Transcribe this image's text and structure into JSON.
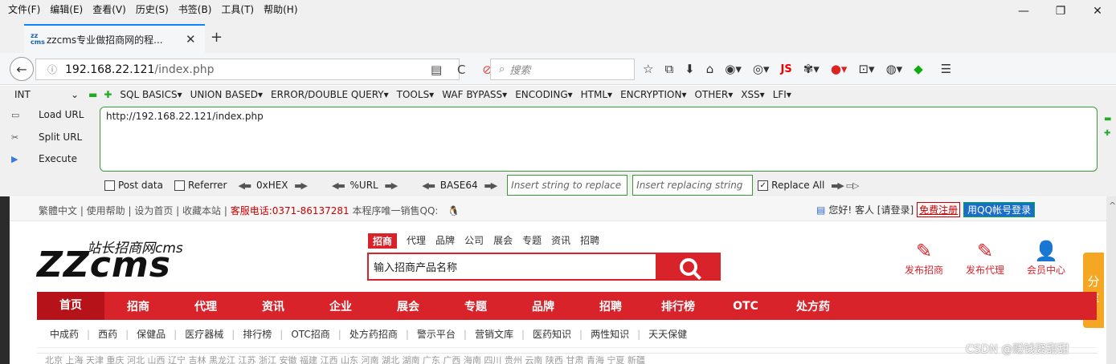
{
  "menubar": {
    "items": [
      "文件(F)",
      "编辑(E)",
      "查看(V)",
      "历史(S)",
      "书签(B)",
      "工具(T)",
      "帮助(H)"
    ]
  },
  "window": {
    "minimize": "—",
    "restore": "❐",
    "close": "✕"
  },
  "tab": {
    "favicon": "zz cms",
    "title": "zzcms专业做招商网的程...",
    "close": "✕",
    "new_tab": "+"
  },
  "navbar": {
    "url_host": "192.168.22.121",
    "url_path": "/index.php",
    "search_placeholder": "搜索",
    "reload": "C",
    "js_label": "JS"
  },
  "hackbar": {
    "select_value": "INT",
    "menus": [
      "SQL BASICS▾",
      "UNION BASED▾",
      "ERROR/DOUBLE QUERY▾",
      "TOOLS▾",
      "WAF BYPASS▾",
      "ENCODING▾",
      "HTML▾",
      "ENCRYPTION▾",
      "OTHER▾",
      "XSS▾",
      "LFI▾"
    ],
    "load_url": "Load URL",
    "split_url": "Split URL",
    "execute": "Execute",
    "url_value": "http://192.168.22.121/index.php",
    "post_data": "Post data",
    "referrer": "Referrer",
    "hex": "0xHEX",
    "urlenc": "%URL",
    "base64": "BASE64",
    "insert_replace_placeholder": "Insert string to replace",
    "insert_replacing_placeholder": "Insert replacing string",
    "replace_all": "Replace All"
  },
  "site": {
    "toplinks": "繁體中文 | 使用帮助 | 设为首页 | 收藏本站 |",
    "hotline": "客服电话:0371-86137281",
    "toplinks_tail": "本程序唯一销售QQ:",
    "greeting": "您好! 客人 [请登录]",
    "register": "免费注册",
    "qq_login": "用QQ帐号登录",
    "logo_big": "ZZcms",
    "logo_small": "站长招商网cms",
    "search_tabs": [
      "招商",
      "代理",
      "品牌",
      "公司",
      "展会",
      "专题",
      "资讯",
      "招聘"
    ],
    "search_placeholder": "输入招商产品名称",
    "publish": [
      {
        "label": "发布招商",
        "icon": "✎"
      },
      {
        "label": "发布代理",
        "icon": "✎"
      },
      {
        "label": "会员中心",
        "icon": "👤"
      }
    ],
    "share": [
      "分",
      "享"
    ],
    "main_nav": [
      "首页",
      "招商",
      "代理",
      "资讯",
      "企业",
      "展会",
      "专题",
      "品牌",
      "招聘",
      "排行榜",
      "OTC",
      "处方药"
    ],
    "sub_nav": [
      "中成药",
      "西药",
      "保健品",
      "医疗器械",
      "排行榜",
      "OTC招商",
      "处方药招商",
      "警示平台",
      "营销文库",
      "医药知识",
      "两性知识",
      "天天保健"
    ],
    "bottom_row": "北京 上海 天津 重庆 河北 山西 辽宁 吉林 黑龙江 江苏 浙江 安徽 福建 江西 山东 河南 湖北 湖南 广东 广西 海南 四川 贵州 云南 陕西 甘肃 青海 宁夏 新疆",
    "watermark": "CSDN @赚钱娶甜甜"
  },
  "colors": {
    "accent": "#d8232a",
    "hackbar_green": "#3a9a3a",
    "tab_indicator": "#0a84ff",
    "share": "#f5a623"
  }
}
